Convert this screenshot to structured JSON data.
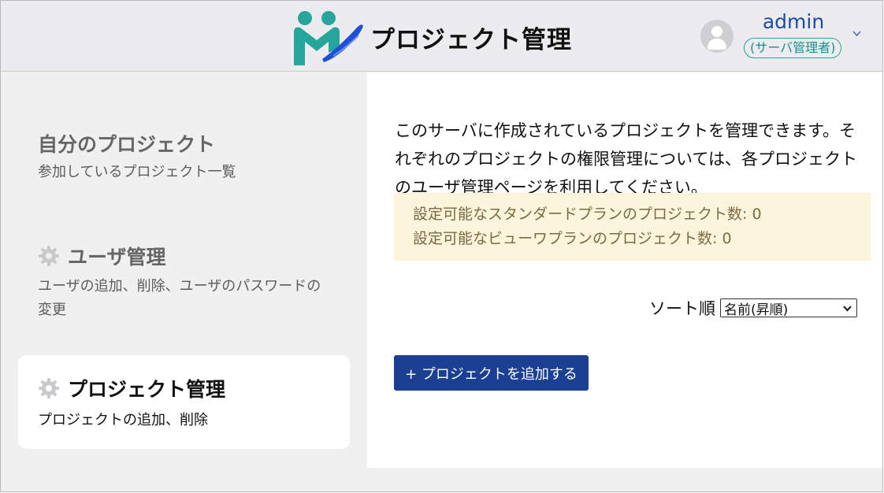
{
  "header": {
    "app_title": "プロジェクト管理",
    "logo_icon": "teal-m-brand-logo",
    "user_name": "admin",
    "user_role": "(サーバ管理者)",
    "avatar_icon": "user-avatar-icon",
    "menu_icon": "chevron-down-icon"
  },
  "sidebar": {
    "items": [
      {
        "title": "自分のプロジェクト",
        "desc": "参加しているプロジェクト一覧",
        "icon": null,
        "active": false
      },
      {
        "title": "ユーザ管理",
        "desc": "ユーザの追加、削除、ユーザのパスワードの変更",
        "icon": "gear-icon",
        "active": false
      },
      {
        "title": "プロジェクト管理",
        "desc": "プロジェクトの追加、削除",
        "icon": "gear-icon",
        "active": true
      }
    ]
  },
  "main": {
    "intro": "このサーバに作成されているプロジェクトを管理できます。それぞれのプロジェクトの権限管理については、各プロジェクトのユーザ管理ページを利用してください。",
    "info_lines": [
      "設定可能なスタンダードプランのプロジェクト数: 0",
      "設定可能なビューワプランのプロジェクト数: 0"
    ],
    "sort_label": "ソート順",
    "sort_value": "名前(昇順)",
    "add_button_label": "+ プロジェクトを追加する"
  },
  "colors": {
    "brand_teal": "#26a69a",
    "brand_blue": "#1f4fd8",
    "button_blue": "#1a3f93",
    "info_bg": "#fdf4dc",
    "role_teal": "#2aa2a0"
  }
}
